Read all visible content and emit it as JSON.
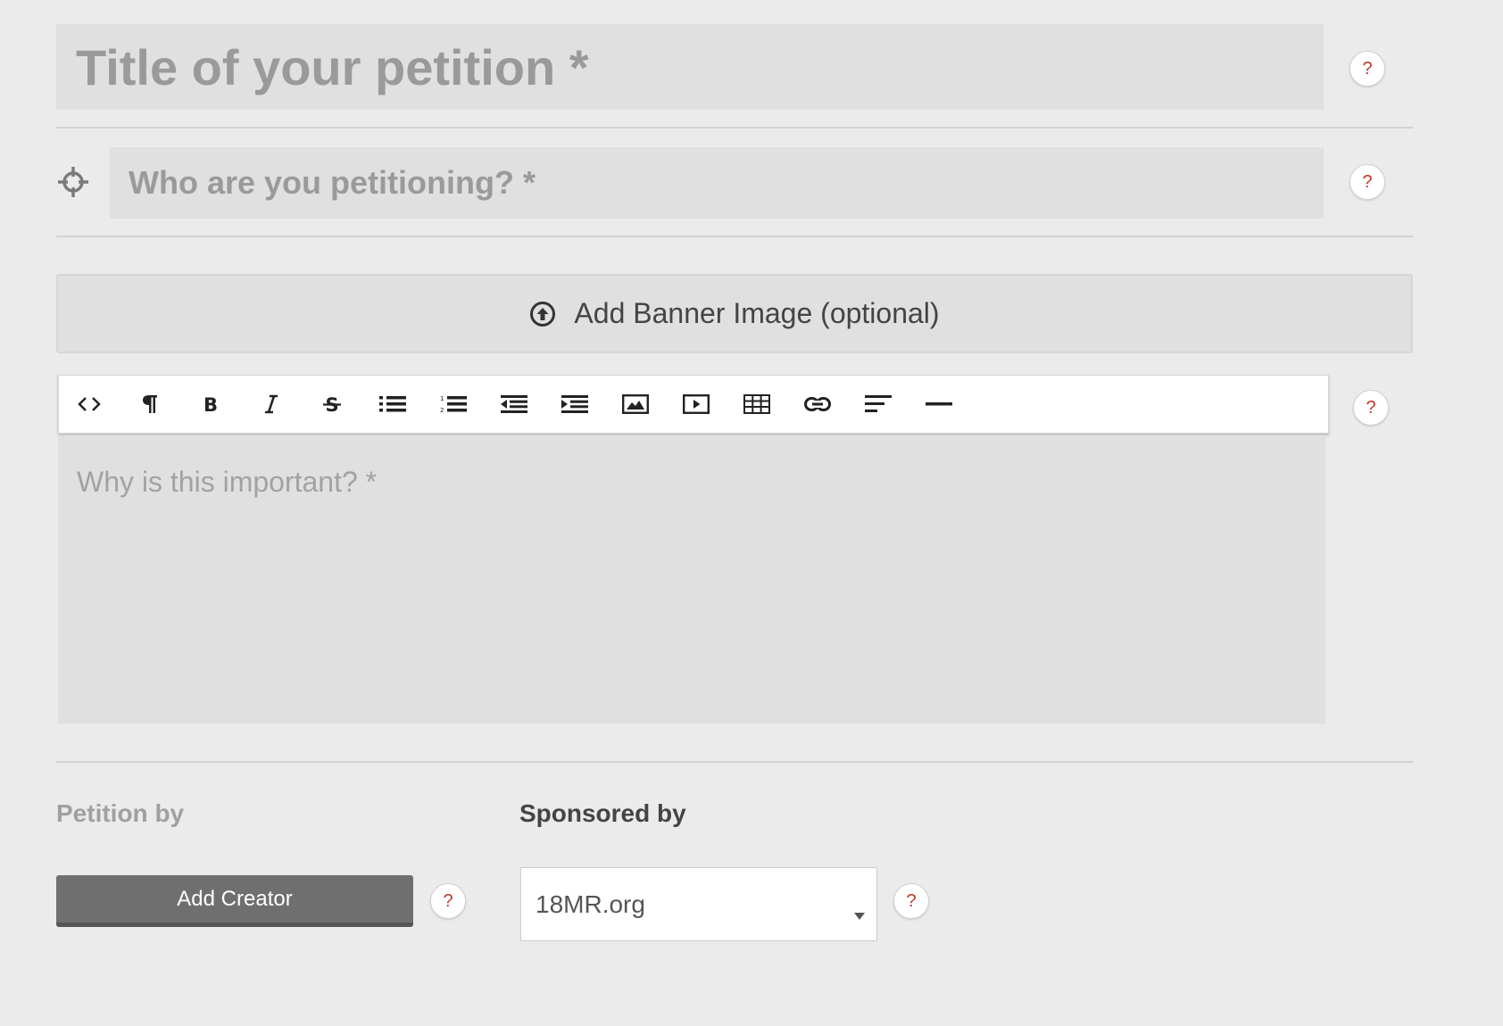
{
  "title_field": {
    "placeholder": "Title of your petition *"
  },
  "target_field": {
    "placeholder": "Who are you petitioning? *",
    "icon": "crosshair-icon"
  },
  "banner_button": {
    "label": "Add Banner Image (optional)",
    "icon": "upload-circle-icon"
  },
  "editor": {
    "toolbar": [
      {
        "name": "html",
        "icon": "code-icon"
      },
      {
        "name": "formatting",
        "icon": "paragraph-icon"
      },
      {
        "name": "bold",
        "icon": "bold-icon"
      },
      {
        "name": "italic",
        "icon": "italic-icon"
      },
      {
        "name": "strikethrough",
        "icon": "strikethrough-icon"
      },
      {
        "name": "unordered-list",
        "icon": "bullet-list-icon"
      },
      {
        "name": "ordered-list",
        "icon": "numbered-list-icon"
      },
      {
        "name": "outdent",
        "icon": "outdent-icon"
      },
      {
        "name": "indent",
        "icon": "indent-icon"
      },
      {
        "name": "image",
        "icon": "image-icon"
      },
      {
        "name": "video",
        "icon": "video-icon"
      },
      {
        "name": "table",
        "icon": "table-icon"
      },
      {
        "name": "link",
        "icon": "link-icon"
      },
      {
        "name": "alignment",
        "icon": "align-left-icon"
      },
      {
        "name": "horizontal-rule",
        "icon": "horizontal-rule-icon"
      }
    ],
    "placeholder": "Why is this important? *"
  },
  "petition_by": {
    "label": "Petition by",
    "button_label": "Add Creator"
  },
  "sponsored_by": {
    "label": "Sponsored by",
    "selected": "18MR.org"
  },
  "help_label": "?",
  "colors": {
    "background": "#ebebeb",
    "field": "#e0e0e0",
    "placeholder": "#9a9a9a",
    "help_mark": "#c0392b",
    "add_creator_button": "#6f6f6f"
  }
}
